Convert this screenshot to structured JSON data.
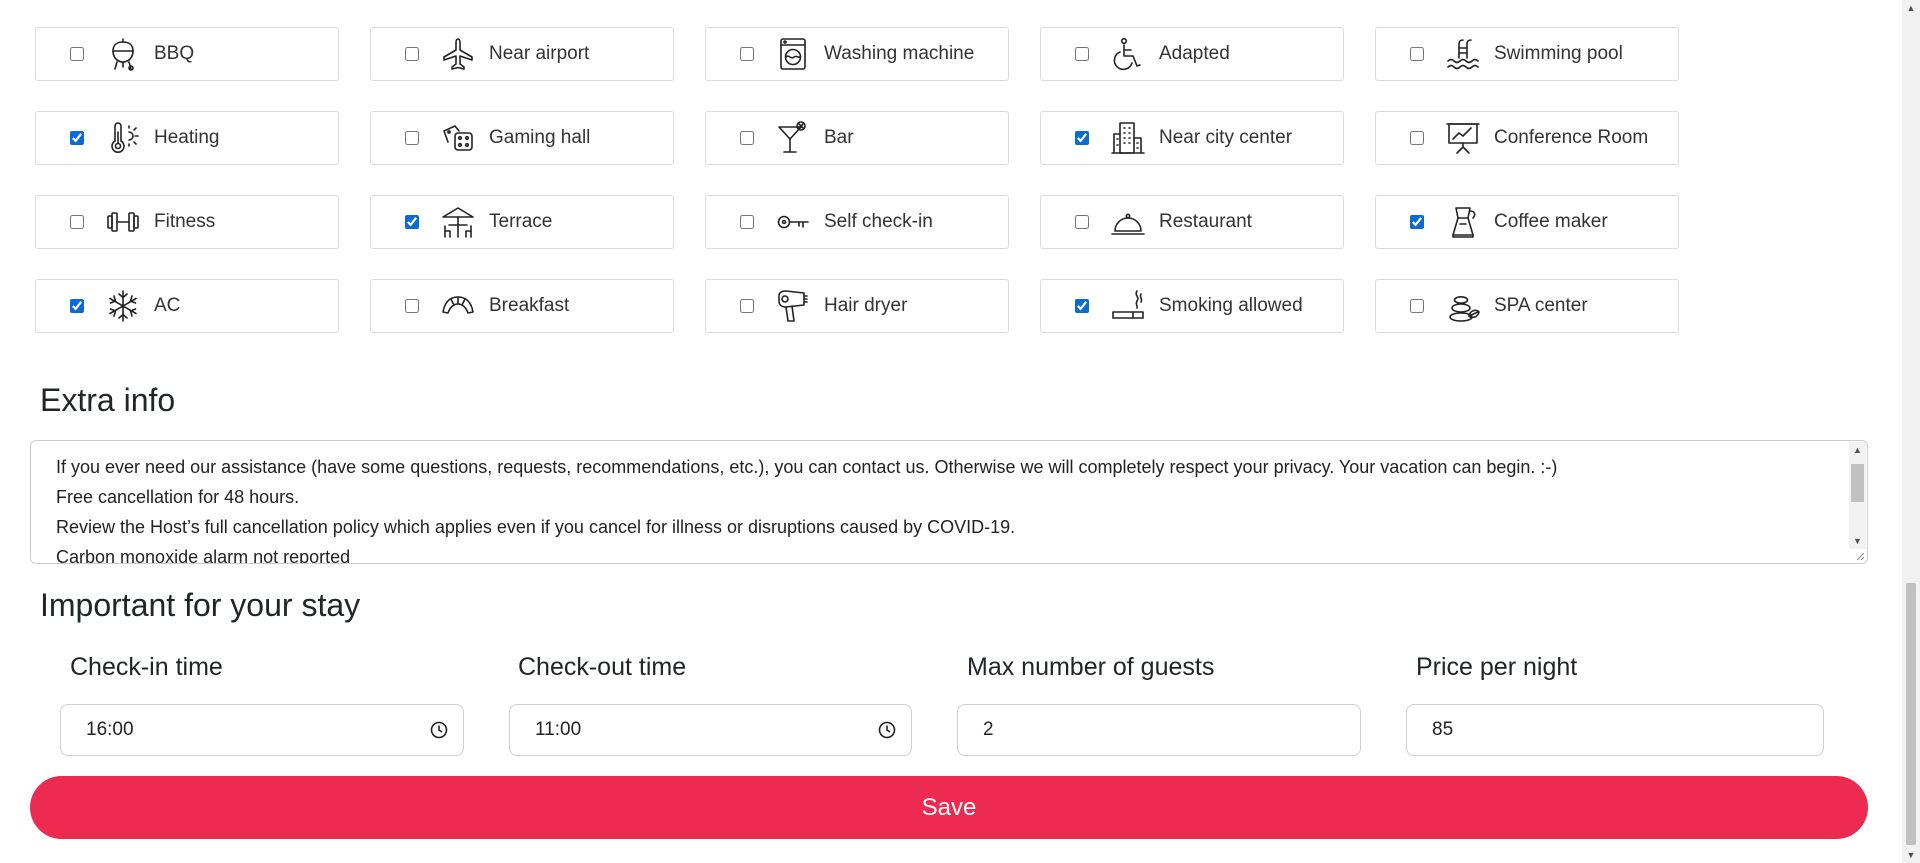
{
  "amenities": [
    {
      "label": "BBQ",
      "icon": "bbq-grill-icon",
      "checked": false
    },
    {
      "label": "Near airport",
      "icon": "airplane-icon",
      "checked": false
    },
    {
      "label": "Washing machine",
      "icon": "washing-machine-icon",
      "checked": false
    },
    {
      "label": "Adapted",
      "icon": "wheelchair-icon",
      "checked": false
    },
    {
      "label": "Swimming pool",
      "icon": "swimming-pool-icon",
      "checked": false
    },
    {
      "label": "Heating",
      "icon": "thermometer-icon",
      "checked": true
    },
    {
      "label": "Gaming hall",
      "icon": "dice-icon",
      "checked": false
    },
    {
      "label": "Bar",
      "icon": "cocktail-icon",
      "checked": false
    },
    {
      "label": "Near city center",
      "icon": "city-building-icon",
      "checked": true
    },
    {
      "label": "Conference Room",
      "icon": "presentation-board-icon",
      "checked": false
    },
    {
      "label": "Fitness",
      "icon": "dumbbell-icon",
      "checked": false
    },
    {
      "label": "Terrace",
      "icon": "terrace-table-icon",
      "checked": true
    },
    {
      "label": "Self check-in",
      "icon": "key-icon",
      "checked": false
    },
    {
      "label": "Restaurant",
      "icon": "cloche-icon",
      "checked": false
    },
    {
      "label": "Coffee maker",
      "icon": "coffee-maker-icon",
      "checked": true
    },
    {
      "label": "AC",
      "icon": "snowflake-icon",
      "checked": true
    },
    {
      "label": "Breakfast",
      "icon": "croissant-icon",
      "checked": false
    },
    {
      "label": "Hair dryer",
      "icon": "hair-dryer-icon",
      "checked": false
    },
    {
      "label": "Smoking allowed",
      "icon": "cigarette-icon",
      "checked": true
    },
    {
      "label": "SPA center",
      "icon": "spa-stones-icon",
      "checked": false
    }
  ],
  "extra_info": {
    "title": "Extra info",
    "lines": [
      "If you ever need our assistance (have some questions, requests, recommendations, etc.), you can contact us. Otherwise we will completely respect your privacy. Your vacation can begin. :-)",
      "Free cancellation for 48 hours.",
      "Review the Host’s full cancellation policy which applies even if you cancel for illness or disruptions caused by COVID-19.",
      "Carbon monoxide alarm not reported"
    ]
  },
  "stay": {
    "title": "Important for your stay",
    "checkin_label": "Check-in time",
    "checkin_value": "16:00",
    "checkout_label": "Check-out time",
    "checkout_value": "11:00",
    "guests_label": "Max number of guests",
    "guests_value": "2",
    "price_label": "Price per night",
    "price_value": "85"
  },
  "save_label": "Save",
  "colors": {
    "accent": "#ed2a4f",
    "checkbox": "#0b6bd3"
  }
}
